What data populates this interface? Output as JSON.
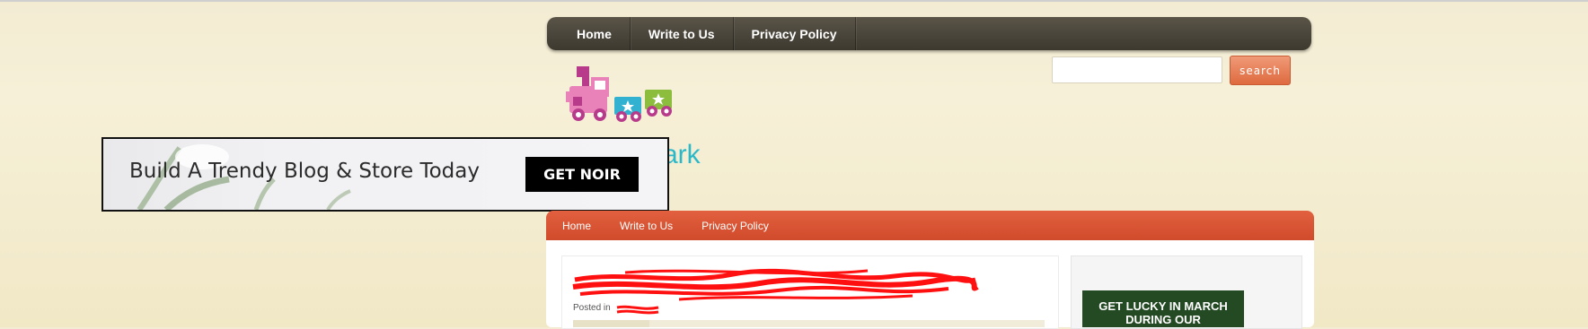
{
  "top_nav": {
    "items": [
      "Home",
      "Write to Us",
      "Privacy Policy"
    ]
  },
  "search": {
    "button_label": "search",
    "value": ""
  },
  "logo": {
    "text": "ark"
  },
  "ad": {
    "headline": "Build A Trendy Blog & Store Today",
    "button_label": "GET NOIR"
  },
  "main_nav": {
    "items": [
      "Home",
      "Write to Us",
      "Privacy Policy"
    ]
  },
  "post": {
    "posted_in": "Posted in"
  },
  "sidebar": {
    "promo_line1": "GET LUCKY IN MARCH",
    "promo_line2": "DURING OUR"
  },
  "colors": {
    "top_nav": "#45413a",
    "main_nav": "#d9553a",
    "search_button": "#e57a52",
    "logo_text": "#2bb8c9",
    "promo": "#244a23"
  },
  "icons": [
    "toy-train-logo"
  ]
}
